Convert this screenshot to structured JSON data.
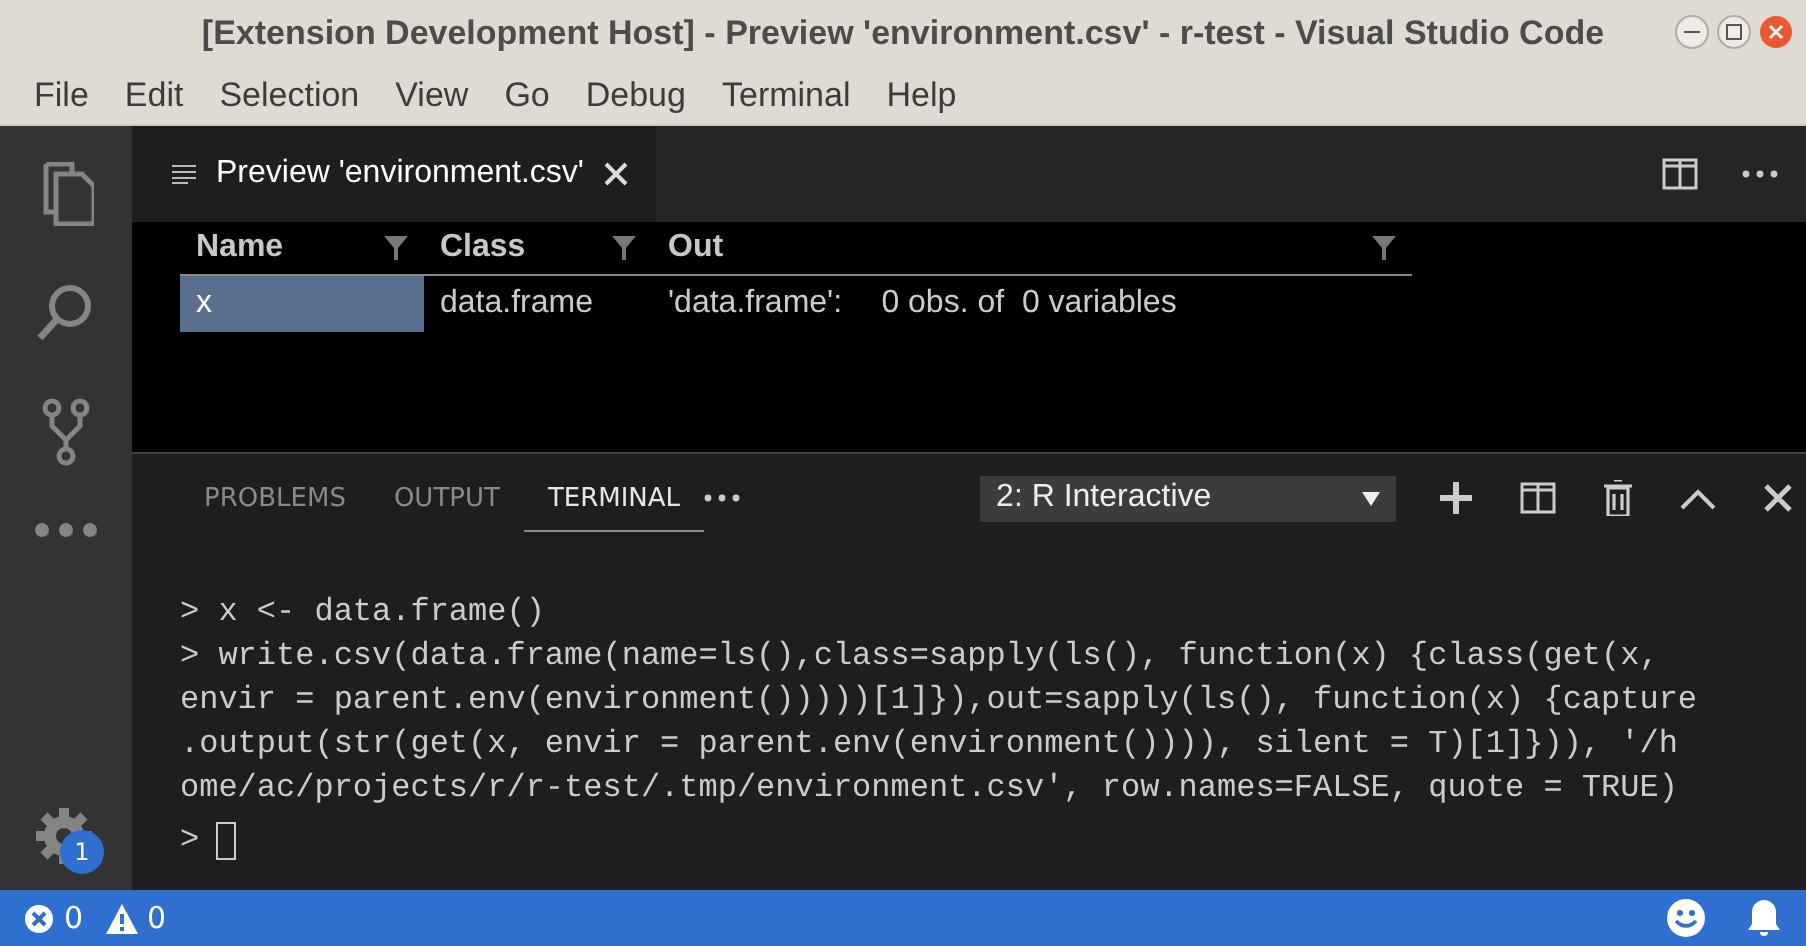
{
  "window": {
    "title": "[Extension Development Host] - Preview 'environment.csv' - r-test - Visual Studio Code"
  },
  "menu": [
    "File",
    "Edit",
    "Selection",
    "View",
    "Go",
    "Debug",
    "Terminal",
    "Help"
  ],
  "activity_bar": {
    "settings_badge": "1"
  },
  "editor_tabs": [
    {
      "label": "Preview 'environment.csv'",
      "selected": true
    }
  ],
  "table": {
    "columns": [
      "Name",
      "Class",
      "Out"
    ],
    "rows": [
      {
        "cells": [
          "x",
          "data.frame",
          "'data.frame':\t0 obs. of  0 variables"
        ],
        "selected": true
      }
    ]
  },
  "panel": {
    "tabs": [
      {
        "label": "PROBLEMS",
        "selected": false
      },
      {
        "label": "OUTPUT",
        "selected": false
      },
      {
        "label": "TERMINAL",
        "selected": true
      }
    ],
    "terminal_select": "2: R Interactive",
    "terminal_lines": [
      "> x <- data.frame()",
      "> write.csv(data.frame(name=ls(),class=sapply(ls(), function(x) {class(get(x,",
      "envir = parent.env(environment()))))[1]}),out=sapply(ls(), function(x) {capture",
      ".output(str(get(x, envir = parent.env(environment()))), silent = T)[1]})), '/h",
      "ome/ac/projects/r/r-test/.tmp/environment.csv', row.names=FALSE, quote = TRUE)"
    ],
    "prompt": ">"
  },
  "status_bar": {
    "errors": "0",
    "warnings": "0"
  }
}
